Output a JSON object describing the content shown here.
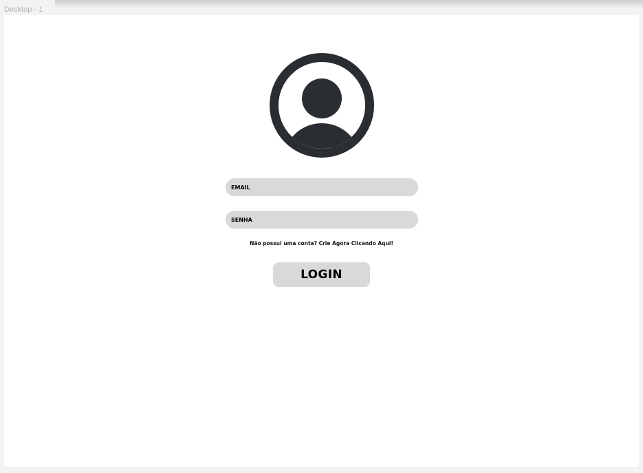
{
  "canvas": {
    "frame_label": "Desktop - 1"
  },
  "login": {
    "avatar_icon": "user-circle-icon",
    "email_placeholder": "EMAIL",
    "password_placeholder": "SENHA",
    "signup_text": "Não possui uma conta? Crie Agora Clicando Aqui!",
    "login_button_label": "LOGIN"
  },
  "colors": {
    "icon": "#2a2d31",
    "field_bg": "#d9d9d9",
    "frame_bg": "#ffffff",
    "canvas_bg": "#f3f3f3"
  }
}
